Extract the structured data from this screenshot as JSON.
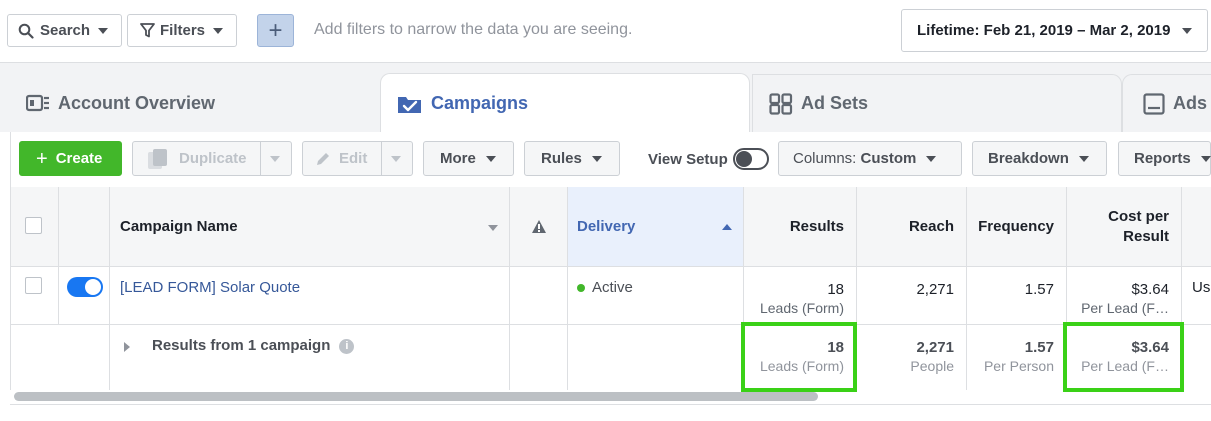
{
  "filter_bar": {
    "search_label": "Search",
    "filters_label": "Filters",
    "add_label": "+",
    "hint": "Add filters to narrow the data you are seeing.",
    "date_range": "Lifetime: Feb 21, 2019 – Mar 2, 2019"
  },
  "tabs": [
    {
      "label": "Account Overview",
      "icon": "account-overview-icon",
      "active": false
    },
    {
      "label": "Campaigns",
      "icon": "folder-check-icon",
      "active": true
    },
    {
      "label": "Ad Sets",
      "icon": "grid-icon",
      "active": false
    },
    {
      "label": "Ads",
      "icon": "ad-icon",
      "active": false
    }
  ],
  "toolbar": {
    "create": "Create",
    "duplicate": "Duplicate",
    "edit": "Edit",
    "more": "More",
    "rules": "Rules",
    "view_setup": "View Setup",
    "columns_prefix": "Columns: ",
    "columns_value": "Custom",
    "breakdown": "Breakdown",
    "reports": "Reports"
  },
  "table": {
    "headers": {
      "campaign_name": "Campaign Name",
      "delivery": "Delivery",
      "results": "Results",
      "reach": "Reach",
      "frequency": "Frequency",
      "cost_per_result_line1": "Cost per",
      "cost_per_result_line2": "Result"
    },
    "rows": [
      {
        "name": "[LEAD FORM] Solar Quote",
        "delivery": "Active",
        "results": "18",
        "results_sub": "Leads (Form)",
        "reach": "2,271",
        "frequency": "1.57",
        "cost": "$3.64",
        "cost_sub": "Per Lead (F…",
        "overflow": "Usi"
      }
    ],
    "summary": {
      "label": "Results from 1 campaign",
      "results": "18",
      "results_sub": "Leads (Form)",
      "reach": "2,271",
      "reach_sub": "People",
      "frequency": "1.57",
      "frequency_sub": "Per Person",
      "cost": "$3.64",
      "cost_sub": "Per Lead (F…"
    }
  },
  "colors": {
    "accent": "#4267b2",
    "create_green": "#42b72a",
    "highlight_green": "#3ad117",
    "toggle_blue": "#1877f2",
    "active_dot": "#42b72a"
  }
}
